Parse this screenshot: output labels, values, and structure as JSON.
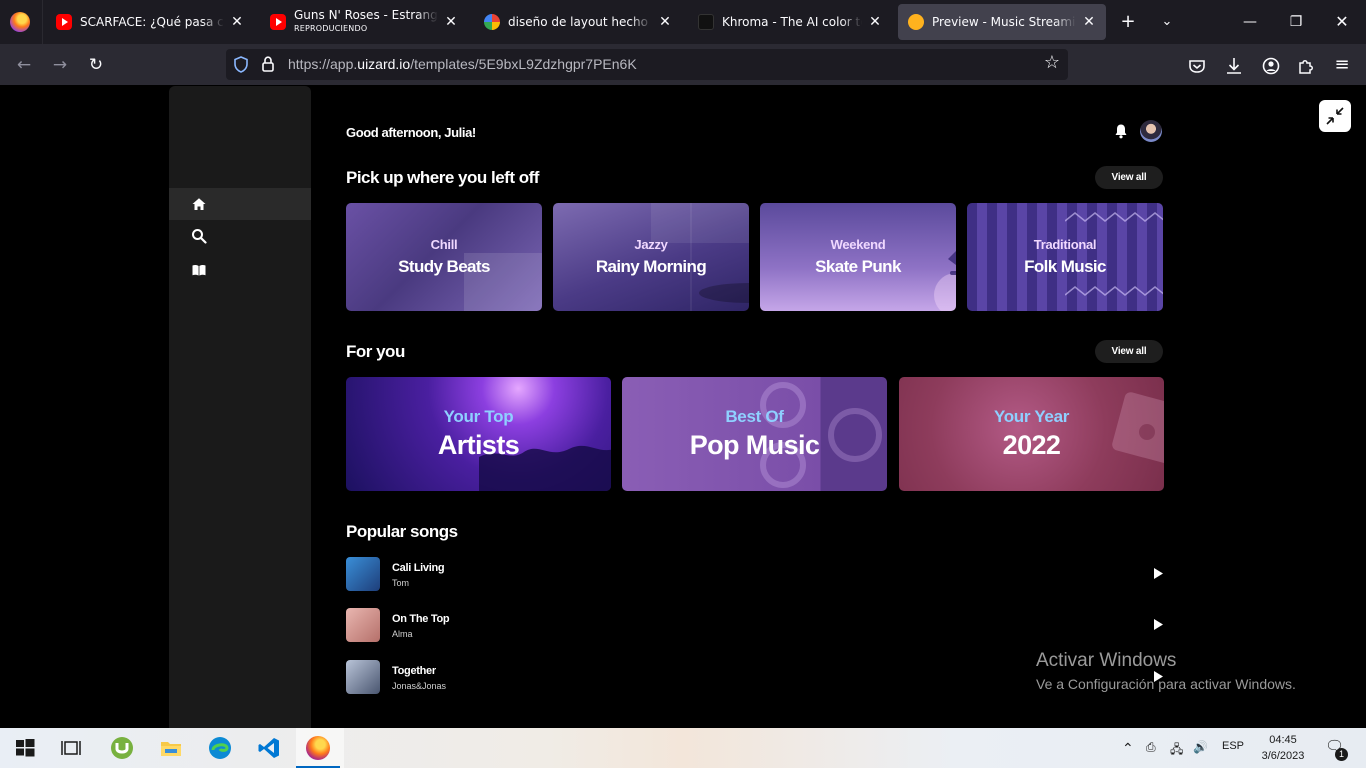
{
  "browser": {
    "tabs": [
      {
        "title": "SCARFACE: ¿Qué pasa cuando",
        "subtitle": "",
        "icon": "youtube-icon"
      },
      {
        "title": "Guns N' Roses - Estranged - Y",
        "subtitle": "REPRODUCIENDO",
        "icon": "youtube-icon"
      },
      {
        "title": "diseño de layout hecho por ia",
        "subtitle": "",
        "icon": "google-icon"
      },
      {
        "title": "Khroma - The AI color tool fo",
        "subtitle": "",
        "icon": "khroma-icon"
      },
      {
        "title": "Preview - Music Streaming Ap",
        "subtitle": "",
        "icon": "uizard-icon"
      }
    ],
    "url_prefix": "https://app.",
    "url_host": "uizard.io",
    "url_path": "/templates/5E9bxL9Zdzhgpr7PEn6K"
  },
  "app": {
    "greeting": "Good afternoon, Julia!",
    "sidebar": [
      {
        "name": "home",
        "icon": "home-icon"
      },
      {
        "name": "search",
        "icon": "search-icon"
      },
      {
        "name": "library",
        "icon": "library-icon"
      }
    ],
    "view_all_label": "View all",
    "sections": {
      "recent": {
        "title": "Pick up where you left off",
        "cards": [
          {
            "kicker": "Chill",
            "title": "Study Beats"
          },
          {
            "kicker": "Jazzy",
            "title": "Rainy Morning"
          },
          {
            "kicker": "Weekend",
            "title": "Skate Punk"
          },
          {
            "kicker": "Traditional",
            "title": "Folk Music"
          }
        ]
      },
      "for_you": {
        "title": "For you",
        "cards": [
          {
            "kicker": "Your Top",
            "title": "Artists"
          },
          {
            "kicker": "Best Of",
            "title": "Pop Music"
          },
          {
            "kicker": "Your Year",
            "title": "2022"
          }
        ]
      },
      "popular": {
        "title": "Popular songs",
        "songs": [
          {
            "name": "Cali Living",
            "artist": "Tom"
          },
          {
            "name": "On The Top",
            "artist": "Alma"
          },
          {
            "name": "Together",
            "artist": "Jonas&Jonas"
          }
        ]
      }
    }
  },
  "watermark": {
    "line1": "Activar Windows",
    "line2": "Ve a Configuración para activar Windows."
  },
  "taskbar": {
    "language": "ESP",
    "time": "04:45",
    "date": "3/6/2023",
    "notification_count": "1"
  },
  "colors": {
    "accent_purple": "#6a51a5",
    "card_kicker_blue": "#8fd0ff",
    "sidebar_bg": "#1a1a1a",
    "page_bg": "#000000"
  }
}
